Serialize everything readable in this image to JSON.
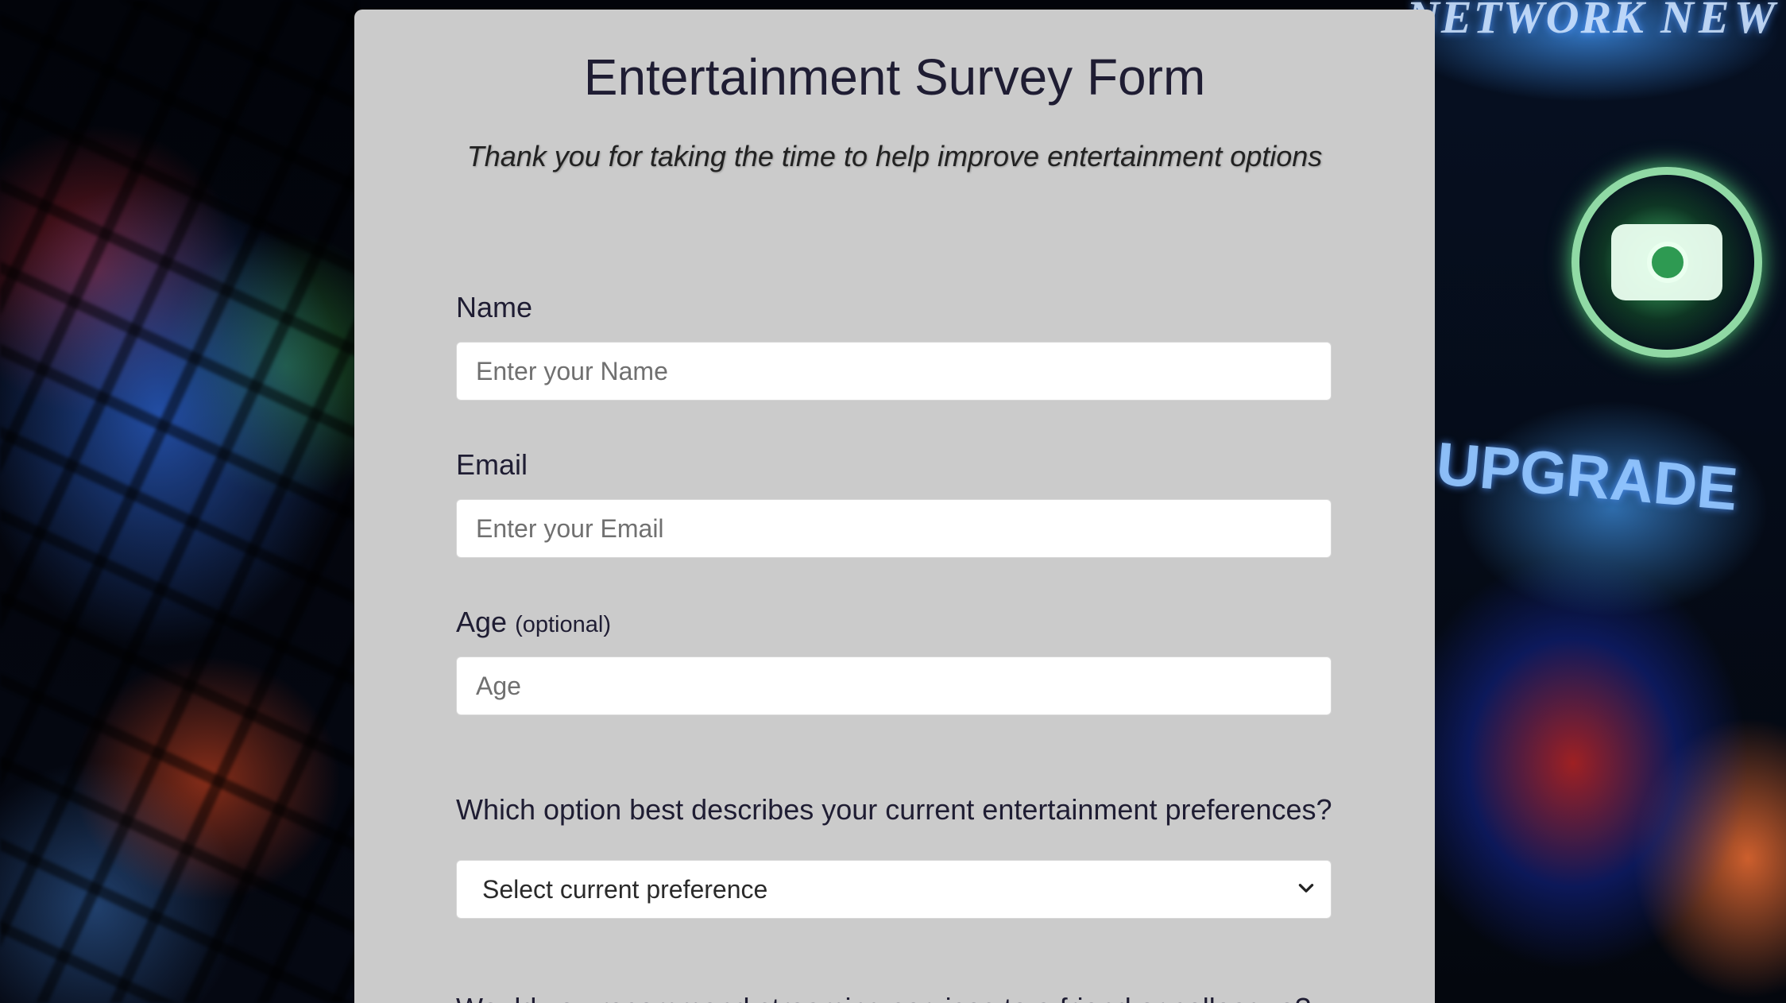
{
  "background": {
    "text_network": "NETWORK",
    "text_news": "NEW",
    "text_upgrade": "UPGRADE",
    "icon": "camera-icon"
  },
  "form": {
    "title": "Entertainment Survey Form",
    "subtitle": "Thank you for taking the time to help improve entertainment options",
    "name": {
      "label": "Name",
      "placeholder": "Enter your Name",
      "value": ""
    },
    "email": {
      "label": "Email",
      "placeholder": "Enter your Email",
      "value": ""
    },
    "age": {
      "label": "Age",
      "label_note": "(optional)",
      "placeholder": "Age",
      "value": ""
    },
    "preference": {
      "question": "Which option best describes your current entertainment preferences?",
      "selected": "Select current preference",
      "icon": "chevron-down-icon"
    },
    "next_question_partial": "Would you recommend streaming services to a friend or colleague?"
  },
  "colors": {
    "card_background": "#cbcbcb",
    "text_primary": "#1f1d33"
  }
}
